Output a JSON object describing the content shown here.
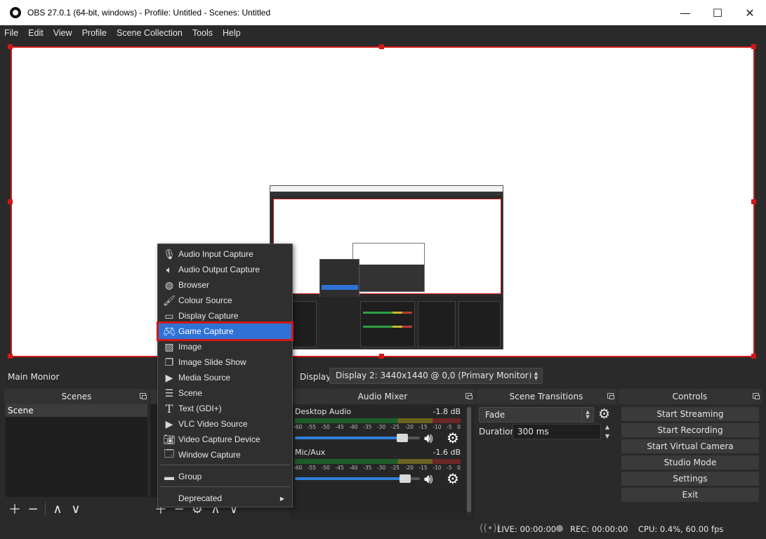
{
  "window": {
    "title": "OBS 27.0.1 (64-bit, windows) - Profile: Untitled - Scenes: Untitled",
    "minimize_glyph": "—",
    "maximize_glyph": "☐",
    "close_glyph": "✕"
  },
  "menubar": [
    "File",
    "Edit",
    "View",
    "Profile",
    "Scene Collection",
    "Tools",
    "Help"
  ],
  "source_toolbar": {
    "source_name": "Main Monior",
    "display_label": "Display",
    "display_value": "Display 2: 3440x1440 @ 0,0 (Primary Monitor)"
  },
  "scenes": {
    "title": "Scenes",
    "items": [
      "Scene"
    ]
  },
  "mixer": {
    "title": "Audio Mixer",
    "ticks": [
      "-60",
      "-55",
      "-50",
      "-45",
      "-40",
      "-35",
      "-30",
      "-25",
      "-20",
      "-15",
      "-10",
      "-5",
      "0"
    ],
    "channels": [
      {
        "name": "Desktop Audio",
        "db": "-1.8 dB",
        "volume": 0.86,
        "level": 0.0
      },
      {
        "name": "Mic/Aux",
        "db": "-1.6 dB",
        "volume": 0.88,
        "level": 0.0
      }
    ]
  },
  "transitions": {
    "title": "Scene Transitions",
    "selected": "Fade",
    "duration_label": "Duration",
    "duration_value": "300 ms"
  },
  "controls": {
    "title": "Controls",
    "buttons": [
      "Start Streaming",
      "Start Recording",
      "Start Virtual Camera",
      "Studio Mode",
      "Settings",
      "Exit"
    ]
  },
  "context_menu": {
    "items": [
      {
        "label": "Audio Input Capture",
        "icon": "microphone-icon"
      },
      {
        "label": "Audio Output Capture",
        "icon": "speaker-icon"
      },
      {
        "label": "Browser",
        "icon": "globe-icon"
      },
      {
        "label": "Colour Source",
        "icon": "brush-icon"
      },
      {
        "label": "Display Capture",
        "icon": "monitor-icon"
      },
      {
        "label": "Game Capture",
        "icon": "gamepad-icon",
        "active": true
      },
      {
        "label": "Image",
        "icon": "image-icon"
      },
      {
        "label": "Image Slide Show",
        "icon": "slideshow-icon"
      },
      {
        "label": "Media Source",
        "icon": "play-icon"
      },
      {
        "label": "Scene",
        "icon": "list-icon"
      },
      {
        "label": "Text (GDI+)",
        "icon": "text-icon"
      },
      {
        "label": "VLC Video Source",
        "icon": "play-icon"
      },
      {
        "label": "Video Capture Device",
        "icon": "camera-icon"
      },
      {
        "label": "Window Capture",
        "icon": "window-icon"
      }
    ],
    "group": {
      "label": "Group",
      "icon": "folder-icon"
    },
    "deprecated": {
      "label": "Deprecated"
    }
  },
  "status": {
    "live": "LIVE: 00:00:00",
    "rec": "REC: 00:00:00",
    "cpu": "CPU: 0.4%, 60.00 fps"
  },
  "colors": {
    "accent": "#2f72d6",
    "selection_outline": "#d01818",
    "panel": "#2a2a2a"
  }
}
